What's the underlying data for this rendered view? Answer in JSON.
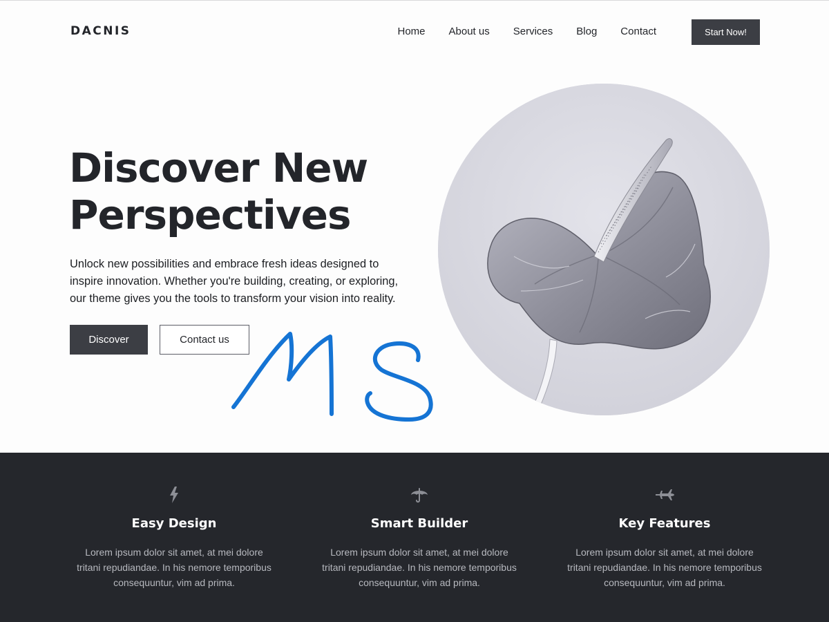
{
  "header": {
    "logo": "DACNIS",
    "nav": [
      "Home",
      "About us",
      "Services",
      "Blog",
      "Contact"
    ],
    "cta": "Start Now!"
  },
  "hero": {
    "title_lines": [
      "Discover New",
      "Perspectives"
    ],
    "text_lines": [
      "Unlock new possibilities and embrace fresh ideas designed to",
      "inspire innovation. Whether you're building, creating, or exploring,",
      "our theme gives you the tools to transform your vision into reality."
    ],
    "primary_button": "Discover",
    "secondary_button": "Contact us",
    "signature_color": "#1574d4"
  },
  "features": [
    {
      "icon": "lightning-icon",
      "title": "Easy Design",
      "desc_lines": [
        "Lorem ipsum dolor sit amet, at mei dolore",
        "tritani repudiandae. In his nemore temporibus",
        "consequuntur, vim ad prima."
      ]
    },
    {
      "icon": "umbrella-icon",
      "title": "Smart Builder",
      "desc_lines": [
        "Lorem ipsum dolor sit amet, at mei dolore",
        "tritani repudiandae. In his nemore temporibus",
        "consequuntur, vim ad prima."
      ]
    },
    {
      "icon": "airplane-icon",
      "title": "Key Features",
      "desc_lines": [
        "Lorem ipsum dolor sit amet, at mei dolore",
        "tritani repudiandae. In his nemore temporibus",
        "consequuntur, vim ad prima."
      ]
    }
  ],
  "colors": {
    "dark": "#25272c",
    "button": "#3c3e44",
    "icon": "#8d8f96"
  }
}
